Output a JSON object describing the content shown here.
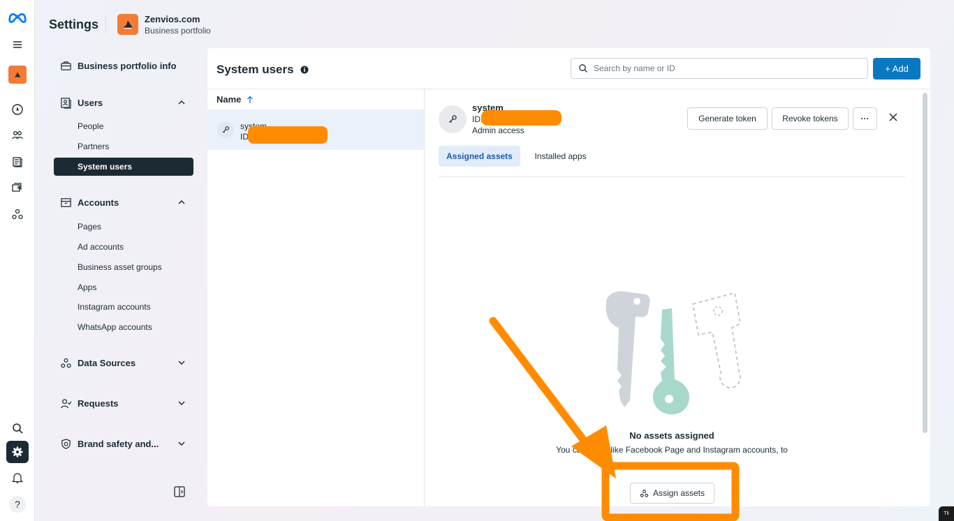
{
  "app": {
    "title": "Settings"
  },
  "business": {
    "name": "Zenvios.com",
    "subtitle": "Business portfolio"
  },
  "rail": {
    "icons": [
      "meta-logo-icon",
      "menu-icon",
      "business-avatar-icon",
      "compass-icon",
      "people-icon",
      "pages-icon",
      "catalog-icon",
      "network-icon",
      "search-icon",
      "settings-icon",
      "bell-icon",
      "help-icon"
    ],
    "help_label": "?"
  },
  "sidebar": {
    "portfolio_info": "Business portfolio info",
    "users": {
      "label": "Users",
      "items": [
        "People",
        "Partners",
        "System users"
      ]
    },
    "accounts": {
      "label": "Accounts",
      "items": [
        "Pages",
        "Ad accounts",
        "Business asset groups",
        "Apps",
        "Instagram accounts",
        "WhatsApp accounts"
      ]
    },
    "data_sources": "Data Sources",
    "requests": "Requests",
    "brand_safety": "Brand safety and..."
  },
  "main": {
    "title": "System users",
    "search_placeholder": "Search by name or ID",
    "add_label": "+ Add",
    "column_name": "Name",
    "row": {
      "name": "system",
      "id_label": "ID"
    }
  },
  "detail": {
    "name": "system",
    "id_label": "ID:",
    "access": "Admin access",
    "generate_token": "Generate token",
    "revoke_tokens": "Revoke tokens",
    "more": "···",
    "tabs": [
      "Assigned assets",
      "Installed apps"
    ],
    "empty_title": "No assets assigned",
    "empty_desc": "You can as          ts, like Facebook Page and Instagram accounts, to",
    "assign_label": "Assign assets"
  },
  "annotation_color": "#ff8c00",
  "corner_badge": "Tli"
}
